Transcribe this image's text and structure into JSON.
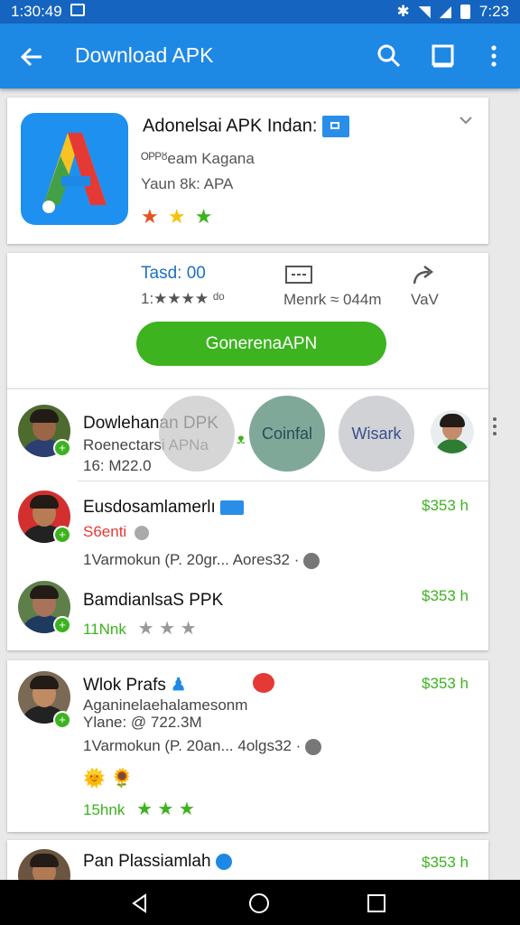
{
  "status": {
    "time_left": "1:30:49",
    "time_right": "7:23"
  },
  "appbar": {
    "title": "Download APK"
  },
  "app": {
    "name": "Adonelsai APK Indan:",
    "developer": "ᴼᴾᴾᴽeam Kagana",
    "version": "Yaun 8k: APA",
    "stars": [
      "★",
      "★",
      "★"
    ],
    "star_colors": [
      "#e8521f",
      "#f4c20d",
      "#3cb31f"
    ]
  },
  "stats": {
    "size_label": "Tasd: 00",
    "rating_text": "1:★★★★ ᵈᵒ",
    "downloads": "Menrk ≈ 044m",
    "share": "VaV"
  },
  "download_button": "GonerenaAPN",
  "overlay": {
    "left": "Dowlehanan DPK",
    "left_sub": "Roenectars",
    "cancel": "Coinfal",
    "wisark": "Wisark",
    "smile": "ᴥ"
  },
  "reviews_group1": [
    {
      "title": "Dowlehanan DPK",
      "line1": "Roenectarsi APNa",
      "line2": "16: M22.0"
    },
    {
      "title": "Eusdosamlamerlı",
      "line1": "S6enti",
      "line2": "1Varmokun (P. 20gr... Aores32 ·",
      "price": "$353 h"
    },
    {
      "title": "BamdianlsaS PPK",
      "line1": "11Nnk",
      "line1_stars": "★ ★ ★",
      "price": "$353 h"
    }
  ],
  "reviews_group2": [
    {
      "title": "Wlok Prafs",
      "line1": "Aganinelaehalamesonm",
      "line2": "Ylane: @ 722.3M",
      "line3": "1Varmokun (P. 20an... 4olgs32 ·",
      "line4": "15hnk",
      "line4_stars": "★ ★ ★",
      "price": "$353 h",
      "emojis": "🌞 🌻"
    },
    {
      "title": "Pan Plassiamlah",
      "price": "$353 h"
    }
  ]
}
